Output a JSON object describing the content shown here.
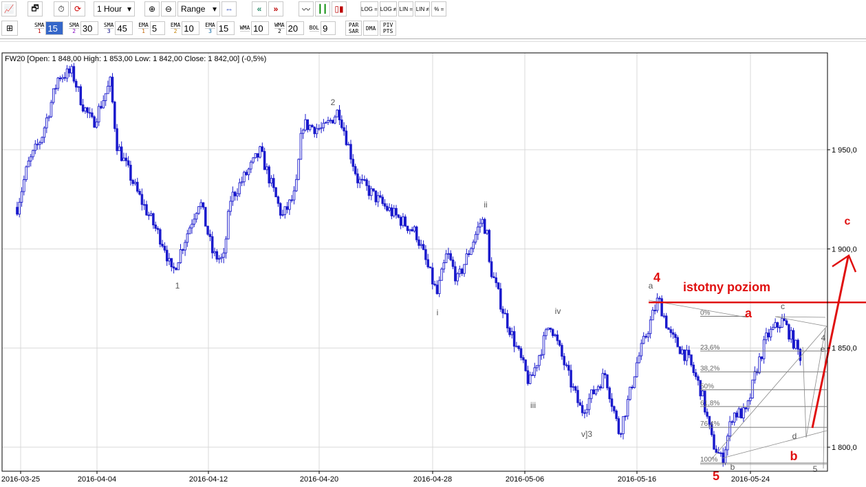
{
  "toolbar": {
    "interval": "1 Hour",
    "range": "Range",
    "scale_buttons": [
      "LOG =",
      "LOG ≠",
      "LIN =",
      "LIN ≠",
      "% ="
    ],
    "indicators": [
      {
        "name": "SMA",
        "sub": "1",
        "value": "15",
        "sub_color": "#c00000",
        "selected": true
      },
      {
        "name": "SMA",
        "sub": "2",
        "value": "30",
        "sub_color": "#8000c0"
      },
      {
        "name": "SMA",
        "sub": "3",
        "value": "45",
        "sub_color": "#000080"
      },
      {
        "name": "EMA",
        "sub": "1",
        "value": "5",
        "sub_color": "#c06000"
      },
      {
        "name": "EMA",
        "sub": "2",
        "value": "10",
        "sub_color": "#c08000"
      },
      {
        "name": "EMA",
        "sub": "3",
        "value": "15",
        "sub_color": "#0060a0"
      },
      {
        "name": "WMA",
        "sub": "",
        "value": "10",
        "sub_color": "#000"
      },
      {
        "name": "WMA",
        "sub": "2",
        "value": "20",
        "sub_color": "#000"
      },
      {
        "name": "BOL",
        "sub": "",
        "value": "9",
        "sub_color": "#000"
      }
    ],
    "extra_buttons": [
      "PAR SAR",
      "DMA",
      "PIV PTS"
    ]
  },
  "header": "FW20 [Open: 1 848,00  High: 1 853,00  Low: 1 842,00  Close: 1 842,00] (-0,5%)",
  "chart_data": {
    "type": "candlestick",
    "symbol": "FW20",
    "interval": "1 Hour",
    "y_ticks": [
      "1 950,0",
      "1 900,0",
      "1 850,0",
      "1 800,0"
    ],
    "y_tick_values": [
      1950,
      1900,
      1850,
      1800
    ],
    "x_ticks": [
      "2016-03-25",
      "2016-04-04",
      "2016-04-12",
      "2016-04-20",
      "2016-04-28",
      "2016-05-06",
      "2016-05-16",
      "2016-05-24"
    ],
    "grid": true,
    "price_path": [
      [
        "2016-03-24 13:00",
        1921
      ],
      [
        "2016-03-25 22:00",
        1942
      ],
      [
        "2016-03-27 17:00",
        1956
      ],
      [
        "2016-03-29 23:00",
        1987
      ],
      [
        "2016-03-31 18:00",
        1989
      ],
      [
        "2016-04-02 02:00",
        1973
      ],
      [
        "2016-04-03 11:00",
        1963
      ],
      [
        "2016-04-04 23:00",
        1984
      ],
      [
        "2016-04-05 10:00",
        1953
      ],
      [
        "2016-04-06 22:00",
        1928
      ],
      [
        "2016-04-08 21:00",
        1901
      ],
      [
        "2016-04-09 09:00",
        1887
      ],
      [
        "2016-04-11 09:00",
        1925
      ],
      [
        "2016-04-12 08:00",
        1897
      ],
      [
        "2016-04-13 02:00",
        1894
      ],
      [
        "2016-04-13 14:00",
        1925
      ],
      [
        "2016-04-15 18:00",
        1949
      ],
      [
        "2016-04-17 08:00",
        1916
      ],
      [
        "2016-04-18 07:00",
        1928
      ],
      [
        "2016-04-18 19:00",
        1963
      ],
      [
        "2016-04-20 07:00",
        1960
      ],
      [
        "2016-04-21 09:00",
        1970
      ],
      [
        "2016-04-22 17:00",
        1935
      ],
      [
        "2016-04-24 16:00",
        1921
      ],
      [
        "2016-04-26 20:00",
        1908
      ],
      [
        "2016-04-28 09:00",
        1877
      ],
      [
        "2016-04-29 06:00",
        1898
      ],
      [
        "2016-04-30 04:00",
        1884
      ],
      [
        "2016-05-02 06:00",
        1915
      ],
      [
        "2016-05-02 17:00",
        1908
      ],
      [
        "2016-05-02 20:00",
        1894
      ],
      [
        "2016-05-04 01:00",
        1870
      ],
      [
        "2016-05-06 10:00",
        1832
      ],
      [
        "2016-05-08 06:00",
        1863
      ],
      [
        "2016-05-10 03:00",
        1832
      ],
      [
        "2016-05-11 01:00",
        1818
      ],
      [
        "2016-05-13 04:00",
        1837
      ],
      [
        "2016-05-14 10:00",
        1807
      ],
      [
        "2016-05-15 08:00",
        1826
      ],
      [
        "2016-05-15 23:00",
        1842
      ],
      [
        "2016-05-17 12:00",
        1875
      ],
      [
        "2016-05-18 09:00",
        1856
      ],
      [
        "2016-05-19 14:00",
        1845
      ],
      [
        "2016-05-20 13:00",
        1828
      ],
      [
        "2016-05-21 07:00",
        1803
      ],
      [
        "2016-05-22 00:00",
        1793
      ],
      [
        "2016-05-22 18:00",
        1817
      ],
      [
        "2016-05-23 17:00",
        1817
      ],
      [
        "2016-05-24 10:00",
        1839
      ],
      [
        "2016-05-25 04:00",
        1856
      ],
      [
        "2016-05-26 07:00",
        1864
      ],
      [
        "2016-05-27 14:00",
        1845
      ]
    ],
    "fibonacci_levels": [
      "0%",
      "23,6%",
      "38,2%",
      "50%",
      "61,8%",
      "76,4%",
      "100%"
    ],
    "fibonacci_prices": [
      1866,
      1848.5,
      1838,
      1829,
      1820.5,
      1810,
      1792
    ],
    "key_level_price": 1873,
    "key_level_label": "istotny poziom",
    "wave_labels": [
      "1",
      "2",
      "i",
      "ii",
      "iii",
      "iv",
      "v]3",
      "a",
      "c",
      "d",
      "e",
      "4",
      "5",
      "b"
    ],
    "red_labels": [
      "4",
      "5",
      "a",
      "b",
      "c"
    ],
    "colors": {
      "bars": "#1a1acc",
      "annotation": "#e01010",
      "grid": "#d8d8d8"
    }
  }
}
